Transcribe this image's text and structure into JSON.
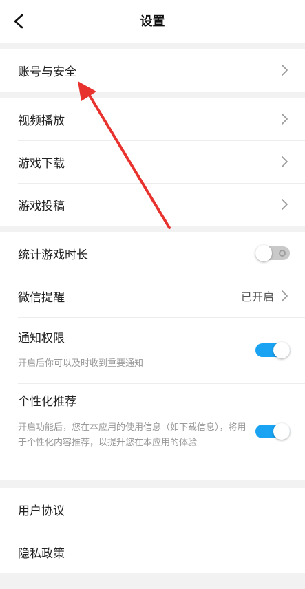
{
  "header": {
    "title": "设置",
    "back_icon": "chevron-left-icon"
  },
  "sections": {
    "account": {
      "label": "账号与安全"
    },
    "media": {
      "video": "视频播放",
      "download": "游戏下载",
      "submit": "游戏投稿"
    },
    "settings": {
      "playtime": {
        "label": "统计游戏时长",
        "enabled": false
      },
      "wechat": {
        "label": "微信提醒",
        "status": "已开启"
      },
      "notify": {
        "label": "通知权限",
        "desc": "开启后你可以及时收到重要通知",
        "enabled": true
      },
      "personalize": {
        "label": "个性化推荐",
        "desc": "开启功能后，您在本应用的使用信息（如下载信息），将用于个性化内容推荐，以提升您在本应用的体验",
        "enabled": true
      }
    },
    "legal": {
      "agreement": "用户协议",
      "privacy": "隐私政策"
    }
  },
  "colors": {
    "toggle_on": "#1aa3f2",
    "toggle_off": "#c9c9c9",
    "annotation_arrow": "#e8322e",
    "background": "#f2f2f2"
  }
}
